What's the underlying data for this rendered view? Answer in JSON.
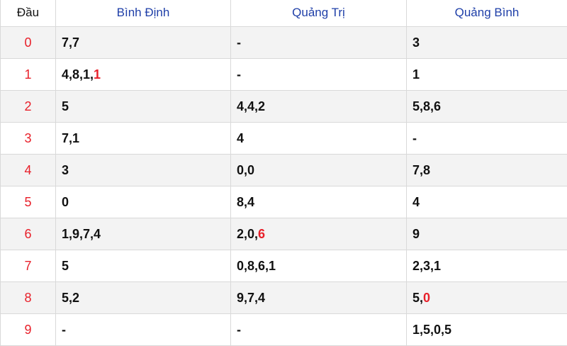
{
  "headers": [
    "Đầu",
    "Bình Định",
    "Quảng Trị",
    "Quảng Bình"
  ],
  "rows": [
    {
      "idx": "0",
      "cells": [
        {
          "text": "7,7",
          "hl": ""
        },
        {
          "text": "-",
          "hl": ""
        },
        {
          "text": "3",
          "hl": ""
        }
      ]
    },
    {
      "idx": "1",
      "cells": [
        {
          "text": "4,8,1,",
          "hl": "1"
        },
        {
          "text": "-",
          "hl": ""
        },
        {
          "text": "1",
          "hl": ""
        }
      ]
    },
    {
      "idx": "2",
      "cells": [
        {
          "text": "5",
          "hl": ""
        },
        {
          "text": "4,4,2",
          "hl": ""
        },
        {
          "text": "5,8,6",
          "hl": ""
        }
      ]
    },
    {
      "idx": "3",
      "cells": [
        {
          "text": "7,1",
          "hl": ""
        },
        {
          "text": "4",
          "hl": ""
        },
        {
          "text": "-",
          "hl": ""
        }
      ]
    },
    {
      "idx": "4",
      "cells": [
        {
          "text": "3",
          "hl": ""
        },
        {
          "text": "0,0",
          "hl": ""
        },
        {
          "text": "7,8",
          "hl": ""
        }
      ]
    },
    {
      "idx": "5",
      "cells": [
        {
          "text": "0",
          "hl": ""
        },
        {
          "text": "8,4",
          "hl": ""
        },
        {
          "text": "4",
          "hl": ""
        }
      ]
    },
    {
      "idx": "6",
      "cells": [
        {
          "text": "1,9,7,4",
          "hl": ""
        },
        {
          "text": "2,0,",
          "hl": "6"
        },
        {
          "text": "9",
          "hl": ""
        }
      ]
    },
    {
      "idx": "7",
      "cells": [
        {
          "text": "5",
          "hl": ""
        },
        {
          "text": "0,8,6,1",
          "hl": ""
        },
        {
          "text": "2,3,1",
          "hl": ""
        }
      ]
    },
    {
      "idx": "8",
      "cells": [
        {
          "text": "5,2",
          "hl": ""
        },
        {
          "text": "9,7,4",
          "hl": ""
        },
        {
          "text": "5,",
          "hl": "0"
        }
      ]
    },
    {
      "idx": "9",
      "cells": [
        {
          "text": "-",
          "hl": ""
        },
        {
          "text": "-",
          "hl": ""
        },
        {
          "text": "1,5,0,5",
          "hl": ""
        }
      ]
    }
  ],
  "colors": {
    "index": "#e8202a",
    "highlight": "#e8202a",
    "header": "#1f3fa8",
    "stripe": "#f3f3f3",
    "border": "#d9d9d9"
  }
}
